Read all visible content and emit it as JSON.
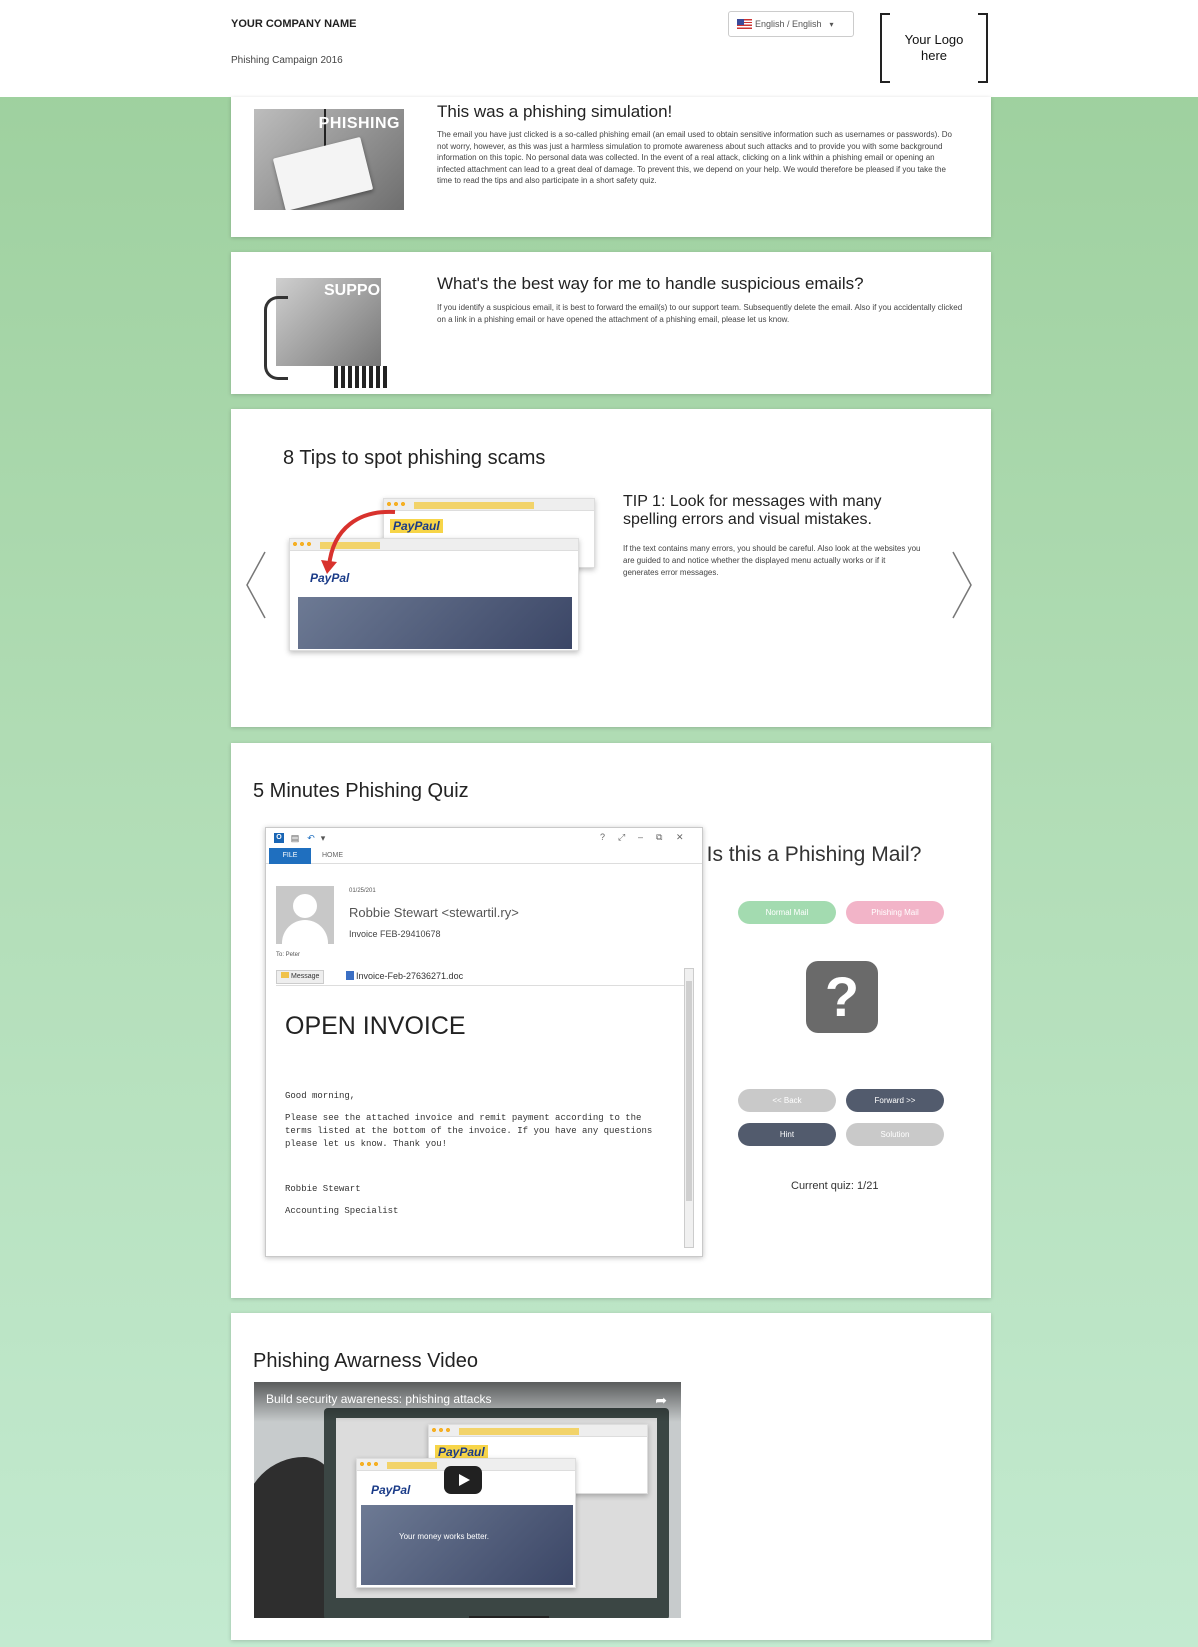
{
  "header": {
    "company_name": "YOUR COMPANY NAME",
    "campaign": "Phishing Campaign 2016",
    "language": "English / English",
    "logo_text": "Your Logo here"
  },
  "intro": {
    "title": "This was a phishing simulation!",
    "body": "The email you have just clicked is a so-called phishing email (an email used to obtain sensitive information such as usernames or passwords). Do not worry, however, as this was just a harmless simulation to promote awareness about such attacks and to provide you with some background information on this topic. No personal data was collected. In the event of a real attack, clicking on a link within a phishing email or opening an infected attachment can lead to a great deal of damage. To prevent this, we depend on your help. We would therefore be pleased if you take the time to read the tips and also participate in a short safety quiz.",
    "image_banner": "PHISHING"
  },
  "support": {
    "title": "What's the best way for me to handle suspicious emails?",
    "body": "If you identify a suspicious email, it is best to forward the email(s) to our support team. Subsequently delete the email. Also if you accidentally clicked on a link in a phishing email or have opened the attachment of a phishing email, please let us know.",
    "image_banner": "SUPPORT"
  },
  "tips": {
    "title": "8 Tips to spot phishing scams",
    "tip_title": "TIP 1: Look for messages with many spelling errors and visual mistakes.",
    "tip_body": "If the text contains many errors, you should be careful. Also look at the websites you are guided to and notice whether the displayed menu actually works or if it generates error messages.",
    "brand_fake": "PayPaul",
    "brand_real": "PayPal"
  },
  "quiz": {
    "title": "5 Minutes Phishing Quiz",
    "mail": {
      "tab_file": "FILE",
      "tab_home": "HOME",
      "date": "01/25/201",
      "from": "Robbie Stewart <stewartil.ry>",
      "subject": "Invoice FEB-29410678",
      "to": "To: Peter",
      "message_button": "Message",
      "attachment": "Invoice-Feb-27636271.doc",
      "heading": "OPEN INVOICE",
      "greeting": "Good morning,",
      "body": "Please see the attached invoice and remit payment according to the terms listed at the bottom of the invoice. If you have any questions please let us know. Thank you!",
      "signature_name": "Robbie Stewart",
      "signature_title": "Accounting Specialist"
    },
    "question": "Is this a Phishing Mail?",
    "normal_label": "Normal Mail",
    "phishing_label": "Phishing Mail",
    "back_label": "<< Back",
    "forward_label": "Forward >>",
    "hint_label": "Hint",
    "solution_label": "Solution",
    "current": "Current quiz: 1/21"
  },
  "video": {
    "title": "Phishing Awarness Video",
    "video_title": "Build security awareness: phishing attacks",
    "caption": "Your money works better."
  },
  "colors": {
    "background": "#a9d8aa",
    "normal_mail": "#a3dbb0",
    "phishing_mail": "#f2b4c8",
    "dark_button": "#525b6d",
    "light_button": "#c9c9c9"
  }
}
